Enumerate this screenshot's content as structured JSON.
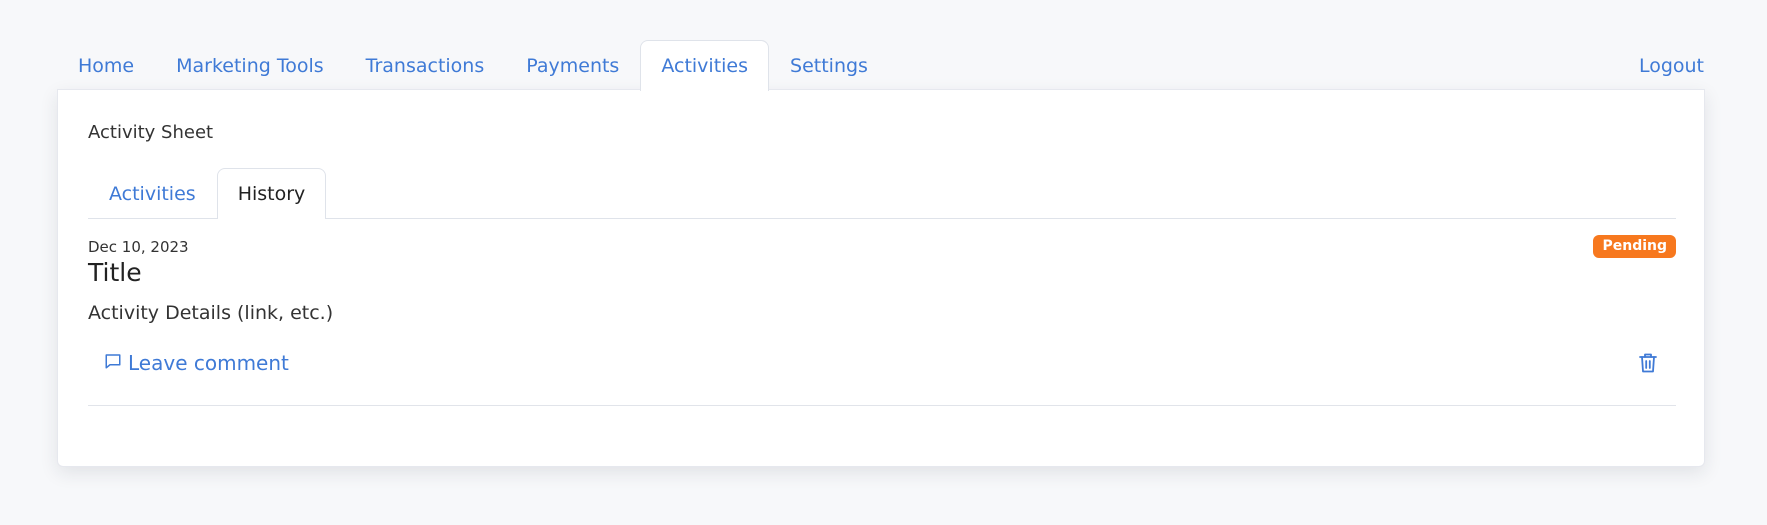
{
  "nav": {
    "tabs": [
      {
        "label": "Home"
      },
      {
        "label": "Marketing Tools"
      },
      {
        "label": "Transactions"
      },
      {
        "label": "Payments"
      },
      {
        "label": "Activities"
      },
      {
        "label": "Settings"
      }
    ],
    "active_tab": "Activities",
    "logout_label": "Logout"
  },
  "sheet": {
    "title": "Activity Sheet",
    "tabs": [
      {
        "label": "Activities"
      },
      {
        "label": "History"
      }
    ],
    "active_tab": "History"
  },
  "activity": {
    "date": "Dec 10, 2023",
    "title": "Title",
    "details": "Activity Details (link, etc.)",
    "status": "Pending",
    "comment_label": "Leave comment"
  },
  "icons": {
    "comment": "comment-icon",
    "delete": "trash-icon"
  },
  "colors": {
    "accent": "#3f7ad6",
    "status_pending": "#f7781e",
    "background": "#f7f8fa"
  }
}
